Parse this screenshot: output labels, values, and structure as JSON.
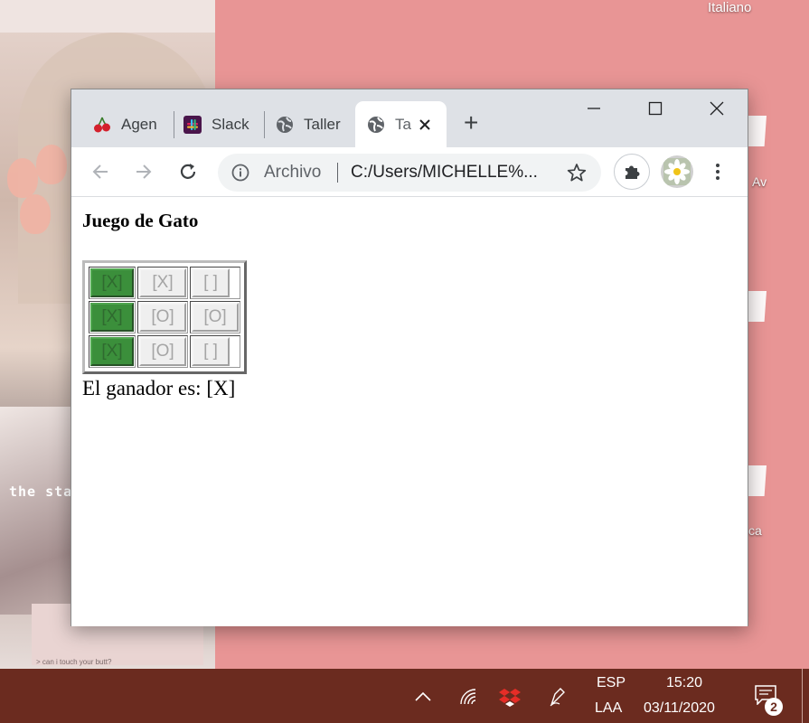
{
  "desktop": {
    "language": "Italiano",
    "icon_labels": [
      "Av",
      "",
      "ca"
    ],
    "wallpaper_text": "the sta",
    "wallpaper_note": "> can i touch your butt?"
  },
  "browser": {
    "tabs": [
      {
        "label": "Agen",
        "icon": "cherries-icon"
      },
      {
        "label": "Slack",
        "icon": "slack-icon"
      },
      {
        "label": "Taller",
        "icon": "globe-icon"
      },
      {
        "label": "Ta",
        "icon": "globe-icon",
        "active": true
      }
    ],
    "new_tab": "+",
    "omnibox": {
      "security_label": "Archivo",
      "url": "C:/Users/MICHELLE%..."
    }
  },
  "page": {
    "title": "Juego de Gato",
    "board": [
      [
        "[X]",
        "[X]",
        "[ ]"
      ],
      [
        "[X]",
        "[O]",
        "[O]"
      ],
      [
        "[X]",
        "[O]",
        "[ ]"
      ]
    ],
    "winning_column": 0,
    "winner_text": "El ganador es: [X]"
  },
  "taskbar": {
    "input_language": "ESP",
    "keyboard_layout": "LAA",
    "time": "15:20",
    "date": "03/11/2020",
    "notification_count": "2"
  },
  "colors": {
    "desktop_bg": "#e89595",
    "taskbar_bg": "#6b2b1f",
    "winning_cell": "#3b8f3b"
  }
}
